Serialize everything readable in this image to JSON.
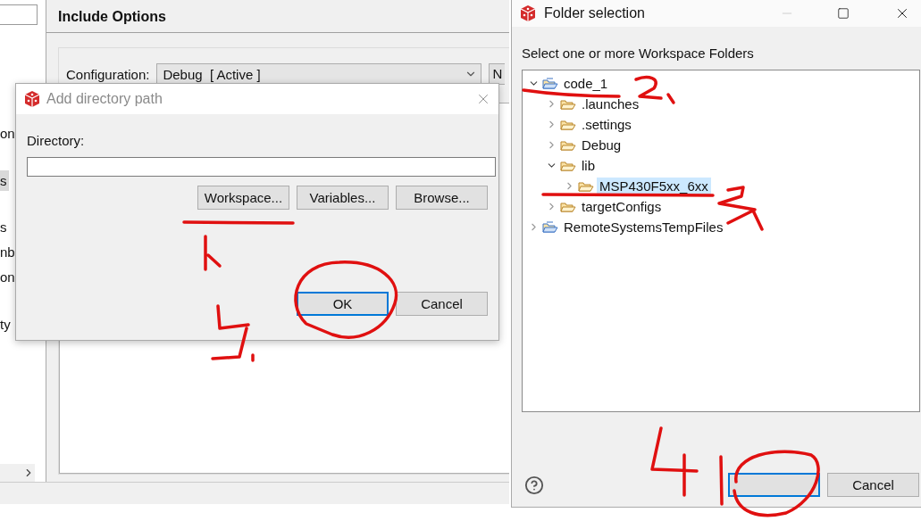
{
  "background_window": {
    "sidebar_items": [
      {
        "label": "on",
        "selected": false
      },
      {
        "label": "s",
        "selected": true
      },
      {
        "label": "s",
        "selected": false
      },
      {
        "label": "nb",
        "selected": false
      },
      {
        "label": "on",
        "selected": false
      },
      {
        "label": "ty",
        "selected": false
      }
    ],
    "page_title": "Include Options",
    "configuration": {
      "label": "Configuration:",
      "value": "Debug  [ Active ]"
    },
    "cut_button": "N"
  },
  "add_directory_dialog": {
    "title": "Add directory path",
    "directory_label": "Directory:",
    "buttons": [
      "Workspace...",
      "Variables...",
      "Browse..."
    ],
    "footer_buttons": [
      {
        "label": "OK",
        "focused": true
      },
      {
        "label": "Cancel",
        "focused": false
      }
    ]
  },
  "folder_selection_dialog": {
    "title": "Folder selection",
    "prompt": "Select one or more Workspace Folders",
    "tree": [
      {
        "label": "code_1",
        "kind": "project",
        "expanded": true,
        "selected": false,
        "children": [
          {
            "label": ".launches",
            "kind": "folder",
            "expanded": false,
            "selected": false
          },
          {
            "label": ".settings",
            "kind": "folder",
            "expanded": false,
            "selected": false
          },
          {
            "label": "Debug",
            "kind": "folder",
            "expanded": false,
            "selected": false
          },
          {
            "label": "lib",
            "kind": "folder",
            "expanded": true,
            "selected": false,
            "children": [
              {
                "label": "MSP430F5xx_6xx",
                "kind": "folder",
                "expanded": false,
                "selected": true
              }
            ]
          },
          {
            "label": "targetConfigs",
            "kind": "folder",
            "expanded": false,
            "selected": false
          }
        ]
      },
      {
        "label": "RemoteSystemsTempFiles",
        "kind": "project",
        "expanded": false,
        "selected": false
      }
    ],
    "footer_buttons": [
      {
        "focused": true
      },
      {
        "label": "Cancel",
        "focused": false
      }
    ]
  }
}
